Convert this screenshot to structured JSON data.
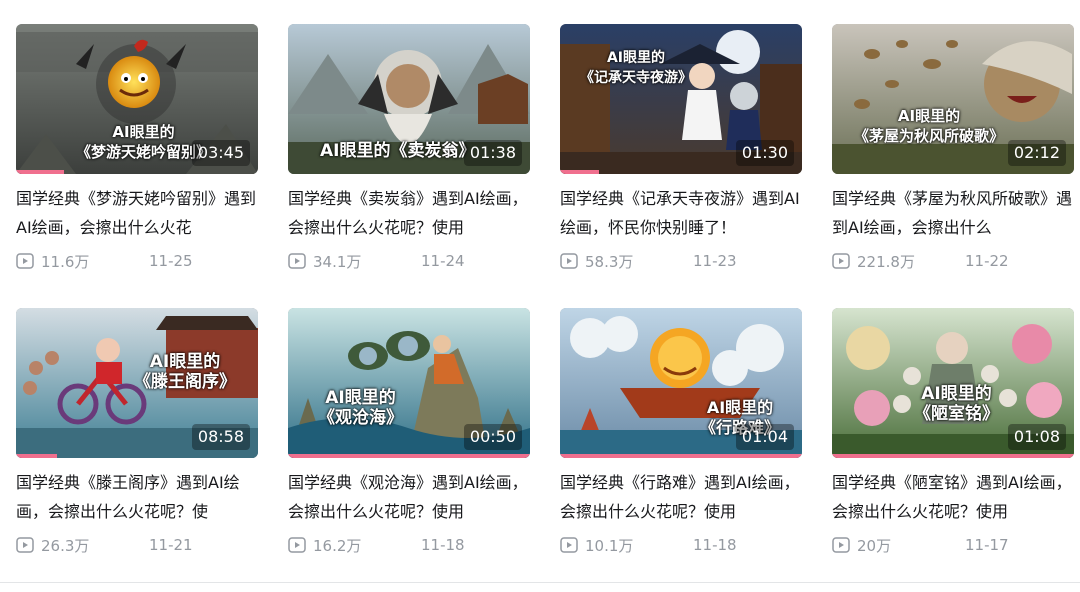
{
  "accent_color": "#f06f8e",
  "videos": [
    {
      "overlay": "AI眼里的\n《梦游天姥吟留别》",
      "duration": "03:45",
      "title": "国学经典《梦游天姥吟留别》遇到AI绘画，会擦出什么火花",
      "views": "11.6万",
      "date": "11-25",
      "progress": 0.2
    },
    {
      "overlay": "AI眼里的《卖炭翁》",
      "duration": "01:38",
      "title": "国学经典《卖炭翁》遇到AI绘画，会擦出什么火花呢？使用",
      "views": "34.1万",
      "date": "11-24",
      "progress": 0
    },
    {
      "overlay": "AI眼里的\n《记承天寺夜游》",
      "duration": "01:30",
      "title": "国学经典《记承天寺夜游》遇到AI绘画，怀民你快别睡了！",
      "views": "58.3万",
      "date": "11-23",
      "progress": 0.16
    },
    {
      "overlay": "AI眼里的\n《茅屋为秋风所破歌》",
      "duration": "02:12",
      "title": "国学经典《茅屋为秋风所破歌》遇到AI绘画，会擦出什么",
      "views": "221.8万",
      "date": "11-22",
      "progress": 0
    },
    {
      "overlay": "AI眼里的\n《滕王阁序》",
      "duration": "08:58",
      "title": "国学经典《滕王阁序》遇到AI绘画，会擦出什么火花呢？使",
      "views": "26.3万",
      "date": "11-21",
      "progress": 0.17
    },
    {
      "overlay": "AI眼里的\n《观沧海》",
      "duration": "00:50",
      "title": "国学经典《观沧海》遇到AI绘画，会擦出什么火花呢？使用",
      "views": "16.2万",
      "date": "11-18",
      "progress": 1.0
    },
    {
      "overlay": "AI眼里的\n《行路难》",
      "duration": "01:04",
      "title": "国学经典《行路难》遇到AI绘画，会擦出什么火花呢？使用",
      "views": "10.1万",
      "date": "11-18",
      "progress": 1.0
    },
    {
      "overlay": "AI眼里的\n《陋室铭》",
      "duration": "01:08",
      "title": "国学经典《陋室铭》遇到AI绘画，会擦出什么火花呢？使用",
      "views": "20万",
      "date": "11-17",
      "progress": 1.0
    }
  ]
}
